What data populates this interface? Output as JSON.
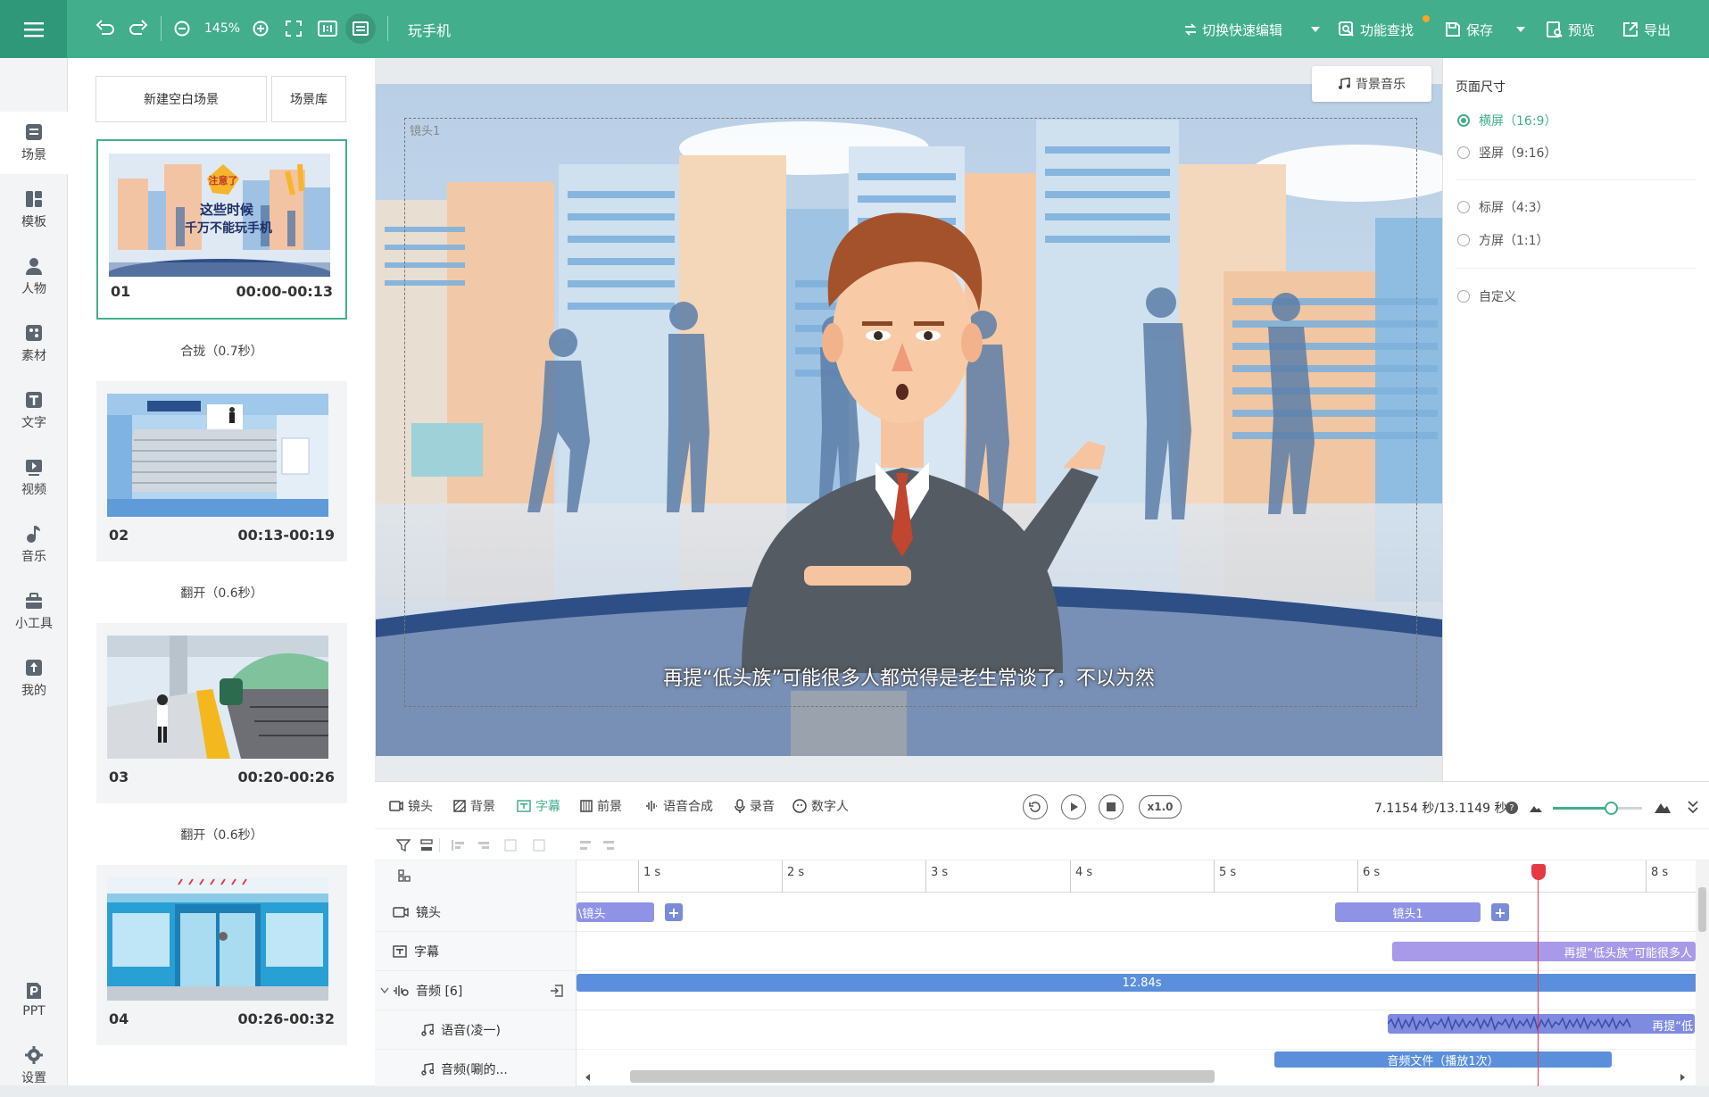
{
  "topbar": {
    "zoom": "145%",
    "project_title": "玩手机",
    "quick_edit": "切换快速编辑",
    "feature_search": "功能查找",
    "save": "保存",
    "preview": "预览",
    "export": "导出"
  },
  "leftnav": {
    "items": [
      {
        "label": "场景",
        "icon": "scene-icon"
      },
      {
        "label": "模板",
        "icon": "template-icon"
      },
      {
        "label": "人物",
        "icon": "person-icon"
      },
      {
        "label": "素材",
        "icon": "material-icon"
      },
      {
        "label": "文字",
        "icon": "text-icon"
      },
      {
        "label": "视频",
        "icon": "video-icon"
      },
      {
        "label": "音乐",
        "icon": "music-icon"
      },
      {
        "label": "小工具",
        "icon": "toolbox-icon"
      },
      {
        "label": "我的",
        "icon": "upload-icon"
      }
    ],
    "ppt": "PPT",
    "settings": "设置"
  },
  "scenes": {
    "new_blank": "新建空白场景",
    "library": "场景库",
    "cards": [
      {
        "num": "01",
        "time": "00:00-00:13",
        "thumb_text_1": "注意了",
        "thumb_text_2": "这些时候",
        "thumb_text_3": "千万不能玩手机"
      },
      {
        "num": "02",
        "time": "00:13-00:19"
      },
      {
        "num": "03",
        "time": "00:20-00:26"
      },
      {
        "num": "04",
        "time": "00:26-00:32"
      }
    ],
    "transitions": [
      "合拢（0.7秒）",
      "翻开（0.6秒）",
      "翻开（0.6秒）"
    ]
  },
  "stage": {
    "bgm_label": "背景音乐",
    "shot_label": "镜头1",
    "subtitle": "再提“低头族”可能很多人都觉得是老生常谈了，不以为然"
  },
  "right_panel": {
    "title": "页面尺寸",
    "options": [
      {
        "label": "横屏（16:9）",
        "selected": true
      },
      {
        "label": "竖屏（9:16）",
        "selected": false
      },
      {
        "label": "标屏（4:3）",
        "selected": false
      },
      {
        "label": "方屏（1:1）",
        "selected": false
      },
      {
        "label": "自定义",
        "selected": false
      }
    ]
  },
  "timeline": {
    "tabs": [
      "镜头",
      "背景",
      "字幕",
      "前景",
      "语音合成",
      "录音",
      "数字人"
    ],
    "active_tab": "字幕",
    "speed": "x1.0",
    "time_readout": "7.1154 秒/13.1149 秒",
    "ticks": [
      "1 s",
      "2 s",
      "3 s",
      "4 s",
      "5 s",
      "6 s",
      "8 s"
    ],
    "rows": [
      {
        "label": "镜头"
      },
      {
        "label": "字幕"
      },
      {
        "label": "音频 [6]"
      },
      {
        "label": "语音(凌一)"
      },
      {
        "label": "音频(唰的..."
      }
    ],
    "clips": {
      "shot_a": "\\镜头",
      "shot_b": "镜头1",
      "subtitle": "再提“低头族”可能很多人",
      "audio_group": "12.84s",
      "voice": "再提“低",
      "sound": "音频文件（播放1次）"
    },
    "colors": {
      "accent": "#42ae8c",
      "clip_purple": "#8f93e6",
      "clip_blue": "#5b8fdc",
      "playhead": "#e53946"
    }
  }
}
